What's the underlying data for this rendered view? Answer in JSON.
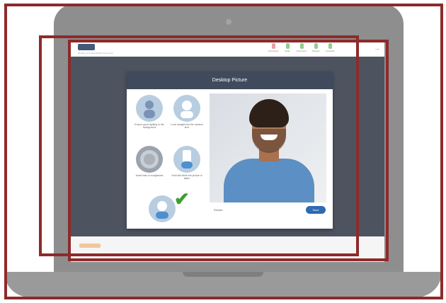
{
  "app": {
    "subtitle": "Develop your Identification Document",
    "next_icon_glyph": "→"
  },
  "steps": [
    {
      "label": "Instructions",
      "color": "#e8a0a4"
    },
    {
      "label": "Selfie",
      "color": "#8fcf8a"
    },
    {
      "label": "Document",
      "color": "#8fcf8a"
    },
    {
      "label": "Address",
      "color": "#8fcf8a"
    },
    {
      "label": "Complete",
      "color": "#8fcf8a"
    }
  ],
  "modal": {
    "title": "Desktop Picture",
    "instructions": [
      {
        "caption": "Ensure good lighting in the background",
        "icon": "person-lighting-icon"
      },
      {
        "caption": "Look straight into the camera lens",
        "icon": "face-front-icon"
      },
      {
        "caption": "Avoid hats or sunglasses",
        "icon": "no-glasses-icon"
      },
      {
        "caption": "Hold still while the picture is taken",
        "icon": "hold-still-icon"
      }
    ],
    "confirm_icon": "checkmark-icon",
    "retake_label": "Retake",
    "save_label": "Save"
  },
  "colors": {
    "frame": "#8e2a2a",
    "modal_header": "#3f4a5c",
    "primary_button": "#2f6ab3",
    "backdrop": "#4e5360"
  }
}
